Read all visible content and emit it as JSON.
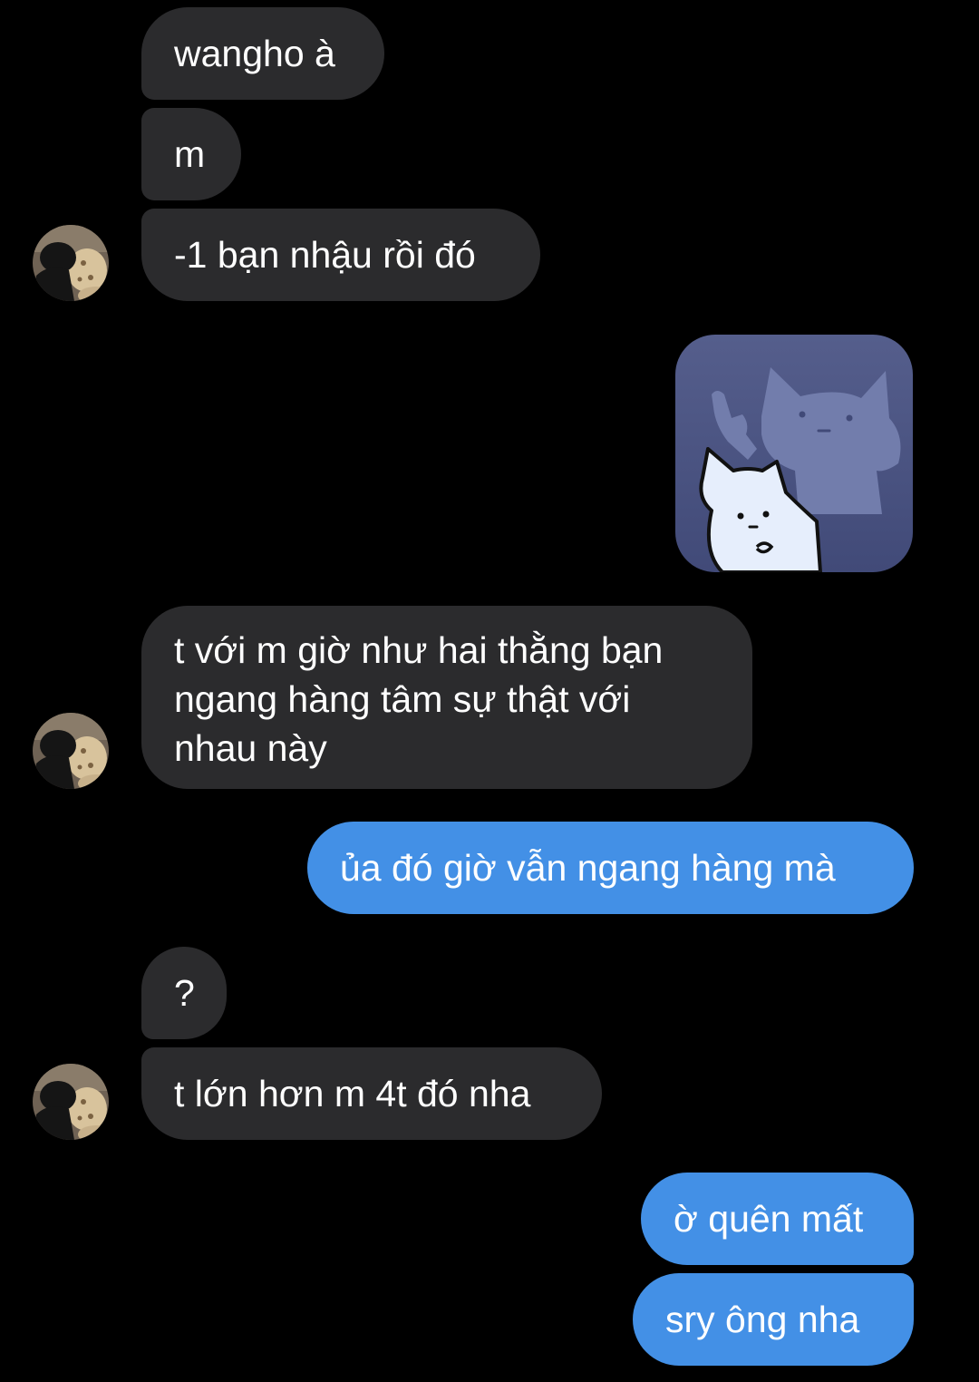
{
  "conversation": {
    "messages": [
      {
        "sender": "other",
        "text": "wangho à"
      },
      {
        "sender": "other",
        "text": "m"
      },
      {
        "sender": "other",
        "text": "-1 bạn nhậu rồi đó"
      },
      {
        "sender": "me",
        "type": "sticker",
        "icon": "cat-sticker"
      },
      {
        "sender": "other",
        "text": "t với m giờ như hai thằng bạn ngang hàng tâm sự thật với nhau này"
      },
      {
        "sender": "me",
        "text": "ủa đó giờ vẫn ngang hàng mà"
      },
      {
        "sender": "other",
        "text": "?"
      },
      {
        "sender": "other",
        "text": "t lớn hơn m 4t đó nha"
      },
      {
        "sender": "me",
        "text": "ờ quên mất"
      },
      {
        "sender": "me",
        "text": "sry ông nha"
      }
    ]
  },
  "colors": {
    "background": "#000000",
    "incoming_bubble": "#2b2b2d",
    "outgoing_bubble": "#4390e6",
    "text": "#ffffff"
  }
}
